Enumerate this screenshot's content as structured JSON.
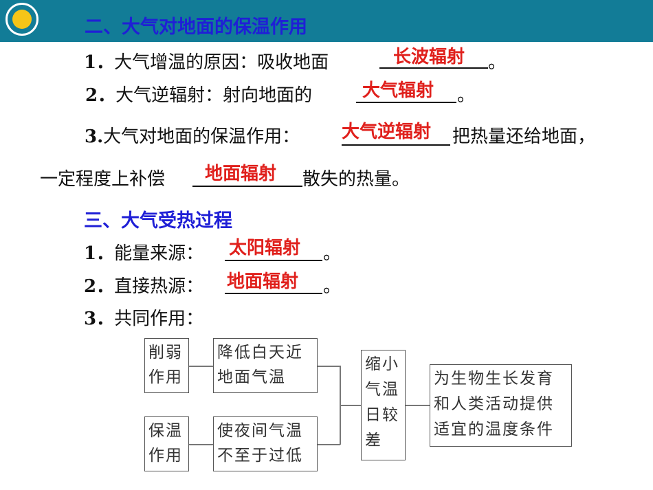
{
  "section2": {
    "heading": "二、大气对地面的保温作用",
    "item1": {
      "num": "1．",
      "text": "大气增温的原因：吸收地面",
      "answer": "长波辐射",
      "end": "。"
    },
    "item2": {
      "num": "2．",
      "text": "大气逆辐射：射向地面的",
      "answer": "大气辐射",
      "end": "。"
    },
    "item3": {
      "num": "3.",
      "text": "大气对地面的保温作用：",
      "answer": "大气逆辐射",
      "after": "把热量还给地面，",
      "line2_text": "一定程度上补偿",
      "line2_answer": "地面辐射",
      "line2_after": "散失的热量。"
    }
  },
  "section3": {
    "heading": "三、大气受热过程",
    "item1": {
      "num": "1．",
      "text": "能量来源：",
      "answer": "太阳辐射",
      "end": "。"
    },
    "item2": {
      "num": "2．",
      "text": "直接热源：",
      "answer": "地面辐射",
      "end": "。"
    },
    "item3": {
      "num": "3．",
      "text": "共同作用："
    }
  },
  "diagram": {
    "weaken": {
      "line1": "削弱",
      "line2": "作用"
    },
    "weaken_effect": {
      "line1": "降低白天近",
      "line2": "地面气温"
    },
    "insulate": {
      "line1": "保温",
      "line2": "作用"
    },
    "insulate_effect": {
      "line1": "使夜间气温",
      "line2": "不至于过低"
    },
    "result": {
      "line1": "缩小",
      "line2": "气温",
      "line3": "日较",
      "line4": "差"
    },
    "final": {
      "line1": "为生物生长发育",
      "line2": "和人类活动提供",
      "line3": "适宜的温度条件"
    }
  }
}
